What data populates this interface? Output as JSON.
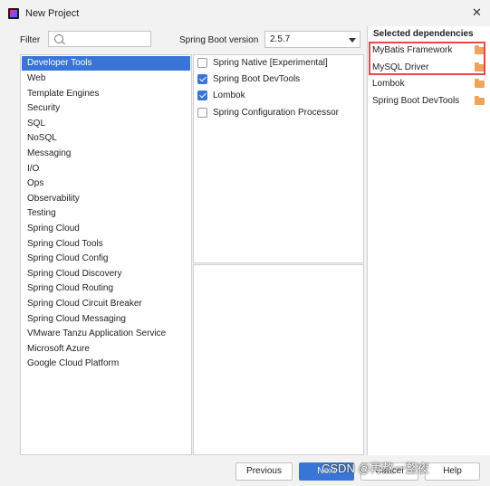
{
  "window": {
    "title": "New Project",
    "close_glyph": "✕"
  },
  "filter": {
    "label": "Filter",
    "value": "",
    "placeholder": ""
  },
  "version": {
    "label": "Spring Boot version",
    "value": "2.5.7"
  },
  "categories": [
    "Developer Tools",
    "Web",
    "Template Engines",
    "Security",
    "SQL",
    "NoSQL",
    "Messaging",
    "I/O",
    "Ops",
    "Observability",
    "Testing",
    "Spring Cloud",
    "Spring Cloud Tools",
    "Spring Cloud Config",
    "Spring Cloud Discovery",
    "Spring Cloud Routing",
    "Spring Cloud Circuit Breaker",
    "Spring Cloud Messaging",
    "VMware Tanzu Application Service",
    "Microsoft Azure",
    "Google Cloud Platform"
  ],
  "selected_category": "Developer Tools",
  "dependencies": [
    {
      "label": "Spring Native [Experimental]",
      "checked": false
    },
    {
      "label": "Spring Boot DevTools",
      "checked": true
    },
    {
      "label": "Lombok",
      "checked": true
    },
    {
      "label": "Spring Configuration Processor",
      "checked": false
    }
  ],
  "selected_deps": {
    "heading": "Selected dependencies",
    "items": [
      "MyBatis Framework",
      "MySQL Driver",
      "Lombok",
      "Spring Boot DevTools"
    ],
    "highlight_color": "#e34a4a"
  },
  "buttons": {
    "previous": "Previous",
    "next": "Next",
    "cancel": "Cancel",
    "help": "Help"
  },
  "watermark": "CSDN @再熬一整夜",
  "colors": {
    "accent": "#3875d7",
    "folder": "#f0a35b"
  }
}
